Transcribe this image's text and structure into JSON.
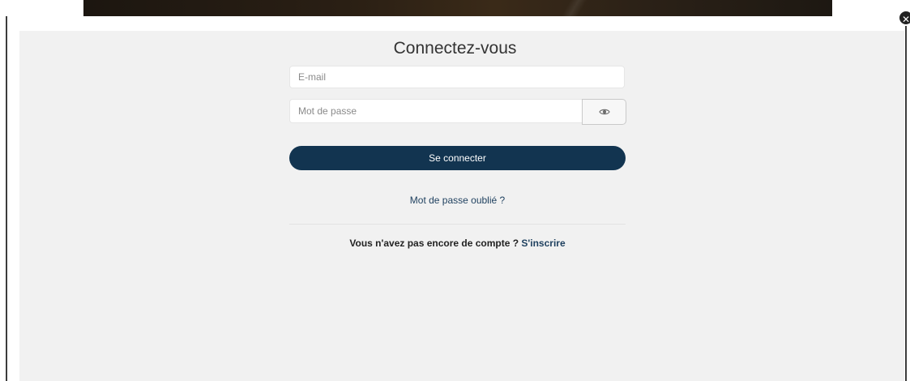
{
  "modal": {
    "close_symbol": "✕"
  },
  "login": {
    "title": "Connectez-vous",
    "email_placeholder": "E-mail",
    "email_value": "",
    "password_placeholder": "Mot de passe",
    "password_value": "",
    "show_password_icon": "eye-icon",
    "submit_label": "Se connecter",
    "forgot_label": "Mot de passe oublié ?",
    "signup_prompt": "Vous n'avez pas encore de compte ?",
    "signup_link": "S'inscrire"
  },
  "colors": {
    "primary": "#123450",
    "link": "#1d3f5e",
    "modal_background": "#f1f1f1"
  }
}
